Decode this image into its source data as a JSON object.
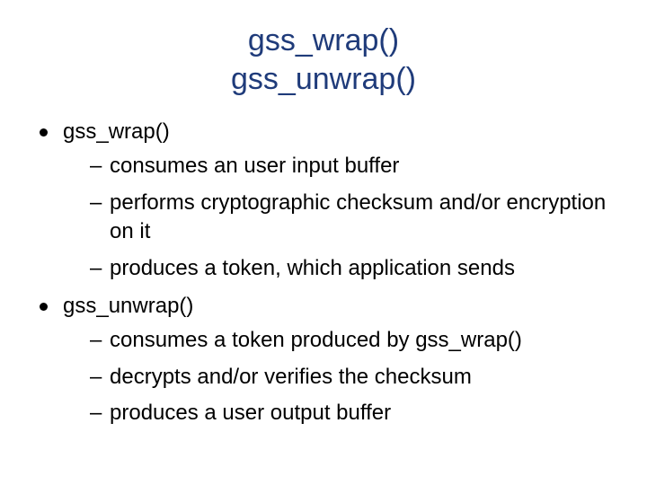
{
  "title_line1": "gss_wrap()",
  "title_line2": "gss_unwrap()",
  "sections": [
    {
      "heading": "gss_wrap()",
      "items": [
        "consumes an user input buffer",
        "performs cryptographic checksum and/or encryption on it",
        "produces a token, which application sends"
      ]
    },
    {
      "heading": "gss_unwrap()",
      "items": [
        "consumes a token produced by gss_wrap()",
        "decrypts and/or verifies the checksum",
        "produces a user output buffer"
      ]
    }
  ]
}
